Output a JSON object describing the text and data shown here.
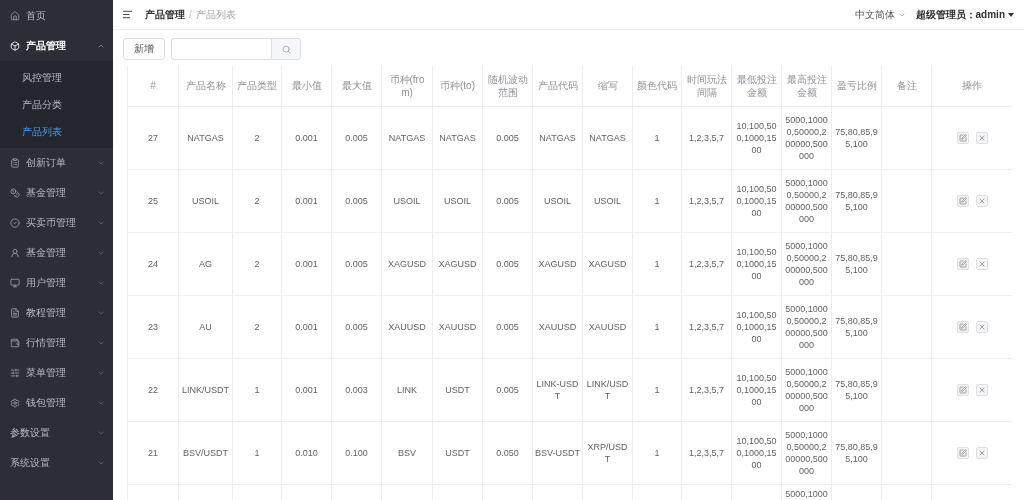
{
  "sidebar": {
    "items": [
      {
        "label": "首页",
        "expanded": false,
        "has_children": false
      },
      {
        "label": "产品管理",
        "expanded": true,
        "has_children": true,
        "children": [
          {
            "label": "风控管理",
            "selected": false
          },
          {
            "label": "产品分类",
            "selected": false
          },
          {
            "label": "产品列表",
            "selected": true
          }
        ]
      },
      {
        "label": "创新订单",
        "expanded": false,
        "has_children": true
      },
      {
        "label": "基金管理",
        "expanded": false,
        "has_children": true
      },
      {
        "label": "买卖币管理",
        "expanded": false,
        "has_children": true
      },
      {
        "label": "基金管理",
        "expanded": false,
        "has_children": true
      },
      {
        "label": "用户管理",
        "expanded": false,
        "has_children": true
      },
      {
        "label": "教程管理",
        "expanded": false,
        "has_children": true
      },
      {
        "label": "行情管理",
        "expanded": false,
        "has_children": true
      },
      {
        "label": "菜单管理",
        "expanded": false,
        "has_children": true
      },
      {
        "label": "钱包管理",
        "expanded": false,
        "has_children": true
      },
      {
        "label": "参数设置",
        "expanded": false,
        "has_children": true
      },
      {
        "label": "系统设置",
        "expanded": false,
        "has_children": true
      }
    ]
  },
  "header": {
    "breadcrumb": [
      "产品管理",
      "产品列表"
    ],
    "breadcrumb_separator": "/",
    "language": "中文简体",
    "user": "超级管理员：admin"
  },
  "toolbar": {
    "add_button": "新增"
  },
  "table": {
    "columns": [
      "#",
      "产品名称",
      "产品类型",
      "最小值",
      "最大值",
      "币种(from)",
      "币种(to)",
      "随机波动范围",
      "产品代码",
      "缩写",
      "颜色代码",
      "时间玩法间隔",
      "最低投注金额",
      "最高投注金额",
      "盈亏比例",
      "备注",
      "操作"
    ],
    "rows": [
      {
        "id": "27",
        "name": "NATGAS",
        "type": "2",
        "min": "0.001",
        "max": "0.005",
        "from": "NATGAS",
        "to": "NATGAS",
        "range": "0.005",
        "code": "NATGAS",
        "abbr": "NATGAS",
        "color_code": "1",
        "time": "1,2,3,5,7",
        "min_bet": "10,100,500,1000,1500",
        "max_bet": "5000,10000,50000,200000,500000",
        "ratio": "75,80,85,95,100"
      },
      {
        "id": "25",
        "name": "USOIL",
        "type": "2",
        "min": "0.001",
        "max": "0.005",
        "from": "USOIL",
        "to": "USOIL",
        "range": "0.005",
        "code": "USOIL",
        "abbr": "USOIL",
        "color_code": "1",
        "time": "1,2,3,5,7",
        "min_bet": "10,100,500,1000,1500",
        "max_bet": "5000,10000,50000,200000,500000",
        "ratio": "75,80,85,95,100"
      },
      {
        "id": "24",
        "name": "AG",
        "type": "2",
        "min": "0.001",
        "max": "0.005",
        "from": "XAGUSD",
        "to": "XAGUSD",
        "range": "0.005",
        "code": "XAGUSD",
        "abbr": "XAGUSD",
        "color_code": "1",
        "time": "1,2,3,5,7",
        "min_bet": "10,100,500,1000,1500",
        "max_bet": "5000,10000,50000,200000,500000",
        "ratio": "75,80,85,95,100"
      },
      {
        "id": "23",
        "name": "AU",
        "type": "2",
        "min": "0.001",
        "max": "0.005",
        "from": "XAUUSD",
        "to": "XAUUSD",
        "range": "0.005",
        "code": "XAUUSD",
        "abbr": "XAUUSD",
        "color_code": "1",
        "time": "1,2,3,5,7",
        "min_bet": "10,100,500,1000,1500",
        "max_bet": "5000,10000,50000,200000,500000",
        "ratio": "75,80,85,95,100"
      },
      {
        "id": "22",
        "name": "LINK/USDT",
        "type": "1",
        "min": "0.001",
        "max": "0.003",
        "from": "LINK",
        "to": "USDT",
        "range": "0.005",
        "code": "LINK-USDT",
        "abbr": "LINK/USDT",
        "color_code": "1",
        "time": "1,2,3,5,7",
        "min_bet": "10,100,500,1000,1500",
        "max_bet": "5000,10000,50000,200000,500000",
        "ratio": "75,80,85,95,100"
      },
      {
        "id": "21",
        "name": "BSV/USDT",
        "type": "1",
        "min": "0.010",
        "max": "0.100",
        "from": "BSV",
        "to": "USDT",
        "range": "0.050",
        "code": "BSV-USDT",
        "abbr": "XRP/USDT",
        "color_code": "1",
        "time": "1,2,3,5,7",
        "min_bet": "10,100,500,1000,1500",
        "max_bet": "5000,10000,50000,200000,500000",
        "ratio": "75,80,85,95,100"
      }
    ],
    "partial_row": {
      "max_bet": "5000,1000"
    }
  }
}
